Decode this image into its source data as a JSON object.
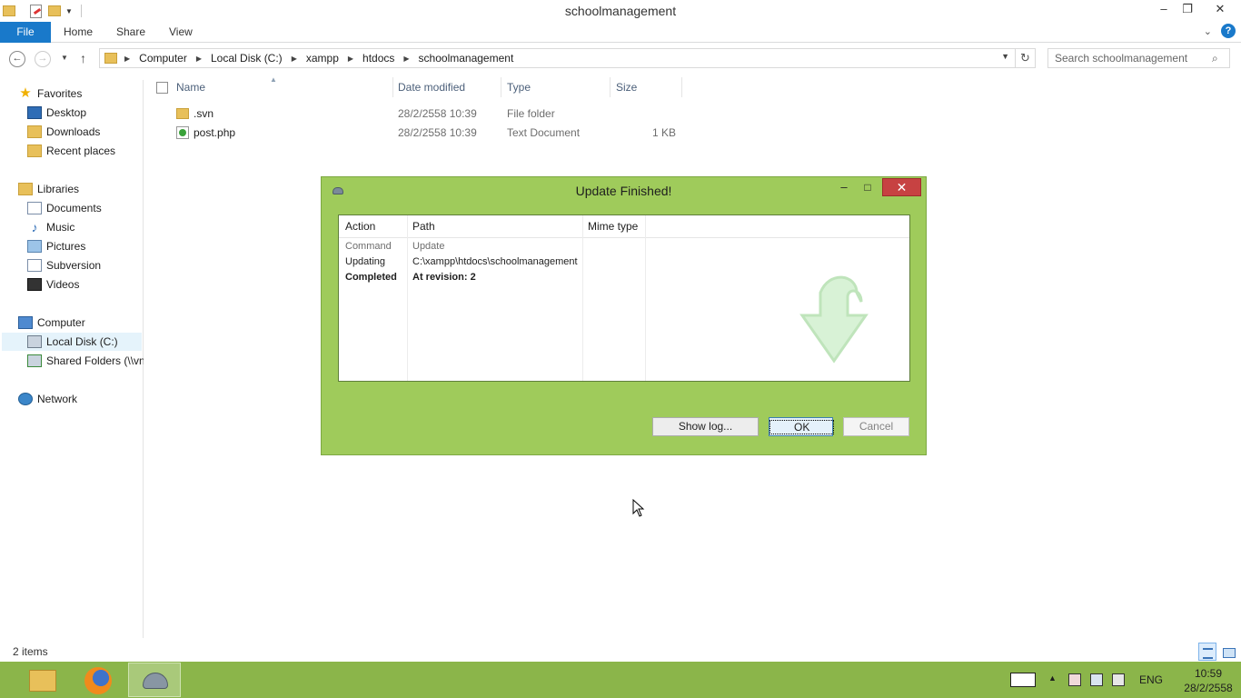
{
  "window": {
    "title": "schoolmanagement",
    "minimize": "–",
    "restore": "❐",
    "close": "✕"
  },
  "ribbon": {
    "tabs": [
      "File",
      "Home",
      "Share",
      "View"
    ],
    "expand_icon": "chevron-down-icon",
    "help": "?"
  },
  "address": {
    "breadcrumbs": [
      "Computer",
      "Local Disk (C:)",
      "xampp",
      "htdocs",
      "schoolmanagement"
    ],
    "search_placeholder": "Search schoolmanagement"
  },
  "navpane": {
    "favorites": {
      "label": "Favorites",
      "items": [
        "Desktop",
        "Downloads",
        "Recent places"
      ]
    },
    "libraries": {
      "label": "Libraries",
      "items": [
        "Documents",
        "Music",
        "Pictures",
        "Subversion",
        "Videos"
      ]
    },
    "computer": {
      "label": "Computer",
      "items": [
        "Local Disk (C:)",
        "Shared Folders (\\\\vn"
      ]
    },
    "network": {
      "label": "Network"
    }
  },
  "filelist": {
    "columns": [
      "Name",
      "Date modified",
      "Type",
      "Size"
    ],
    "rows": [
      {
        "name": ".svn",
        "date": "28/2/2558 10:39",
        "type": "File folder",
        "size": ""
      },
      {
        "name": "post.php",
        "date": "28/2/2558 10:39",
        "type": "Text Document",
        "size": "1 KB"
      }
    ]
  },
  "status": {
    "count": "2 items"
  },
  "dialog": {
    "title": "Update Finished!",
    "columns": [
      "Action",
      "Path",
      "Mime type"
    ],
    "rows": [
      {
        "action": "Command",
        "path": "Update"
      },
      {
        "action": "Updating",
        "path": "C:\\xampp\\htdocs\\schoolmanagement"
      },
      {
        "action": "Completed",
        "path": "At revision: 2"
      }
    ],
    "buttons": {
      "show_log": "Show log...",
      "ok": "OK",
      "cancel": "Cancel"
    }
  },
  "taskbar": {
    "apps": [
      "file-explorer",
      "firefox",
      "tortoisesvn"
    ],
    "language": "ENG",
    "time": "10:59",
    "date": "28/2/2558"
  },
  "colors": {
    "dialog_bg": "#9fcb5b",
    "taskbar_bg": "#8bb54a",
    "file_tab": "#1979ca",
    "close_red": "#c74242"
  }
}
